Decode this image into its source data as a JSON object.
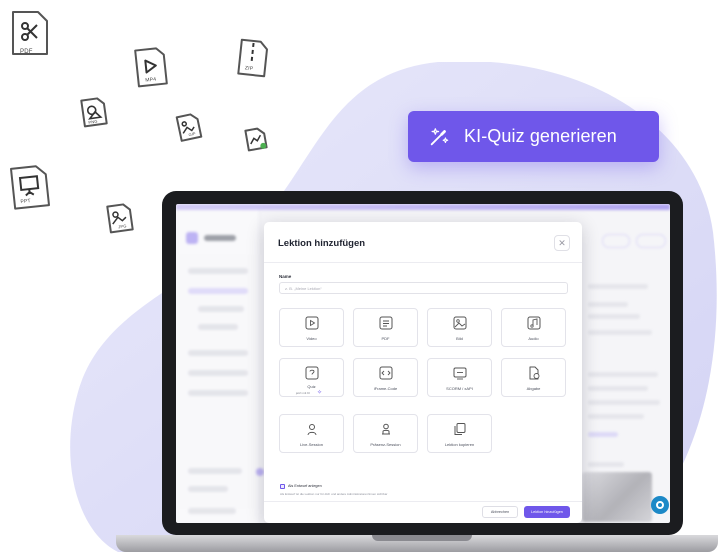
{
  "cta": {
    "label": "KI-Quiz generieren"
  },
  "file_icons": [
    {
      "type": "PDF",
      "icon": "pdf-file-icon"
    },
    {
      "type": "MP4",
      "icon": "video-file-icon"
    },
    {
      "type": "ZIP",
      "icon": "zip-file-icon"
    },
    {
      "type": "PNG",
      "icon": "png-file-icon"
    },
    {
      "type": "GIF",
      "icon": "gif-file-icon"
    },
    {
      "type": "PPT",
      "icon": "ppt-file-icon"
    },
    {
      "type": "JPG",
      "icon": "jpg-file-icon"
    }
  ],
  "modal": {
    "title": "Lektion hinzufügen",
    "close_icon": "close-icon",
    "name_label": "Name",
    "name_placeholder": "z. B. „Meine Lektion“",
    "lesson_types": [
      {
        "label": "Video",
        "icon": "video-icon"
      },
      {
        "label": "PDF",
        "icon": "pdf-icon"
      },
      {
        "label": "Bild",
        "icon": "image-icon"
      },
      {
        "label": "Audio",
        "icon": "audio-icon"
      },
      {
        "label": "Quiz",
        "icon": "quiz-icon",
        "badge": "jetzt mit KI"
      },
      {
        "label": "iFrame-Code",
        "icon": "embed-icon"
      },
      {
        "label": "SCORM / xAPI",
        "icon": "scorm-icon"
      },
      {
        "label": "Abgabe",
        "icon": "submission-icon"
      },
      {
        "label": "Live-Session",
        "icon": "live-session-icon"
      },
      {
        "label": "Präsenz-Session",
        "icon": "presence-session-icon"
      },
      {
        "label": "Lektion kopieren",
        "icon": "copy-icon"
      }
    ],
    "draft_checkbox": {
      "label": "Als Entwurf anlegen",
      "checked": true,
      "hint": "Als Entwurf ist die Lektion nur für dich und andere Administratoren/innen sichtbar"
    },
    "cancel_label": "Abbrechen",
    "submit_label": "Lektion hinzufügen"
  },
  "colors": {
    "accent": "#6f57ea",
    "blob": "#dcdcf7",
    "laptop": "#1b1c1f",
    "chat": "#1d89c7"
  }
}
